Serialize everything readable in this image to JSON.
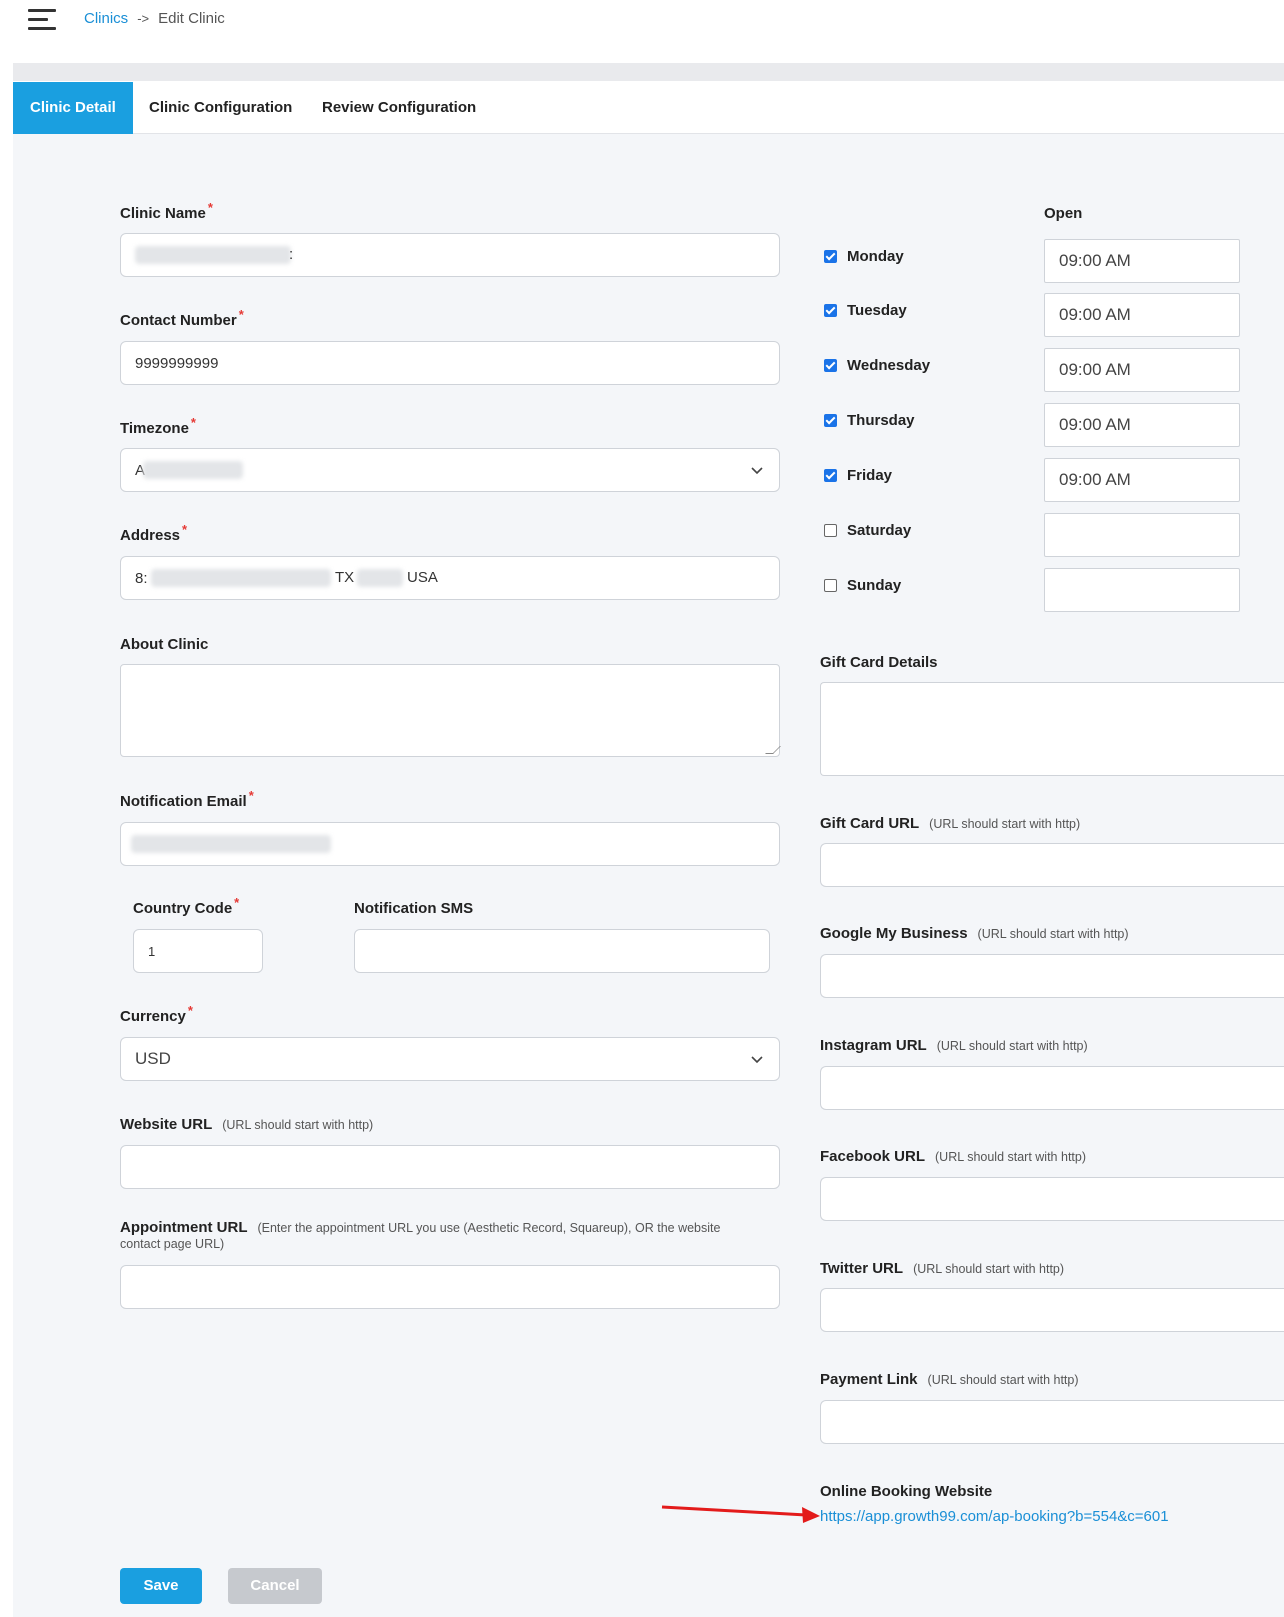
{
  "breadcrumb": {
    "root": "Clinics",
    "separator": "->",
    "current": "Edit Clinic"
  },
  "tabs": [
    {
      "label": "Clinic Detail",
      "active": true
    },
    {
      "label": "Clinic Configuration",
      "active": false
    },
    {
      "label": "Review Configuration",
      "active": false
    }
  ],
  "form": {
    "clinic_name": {
      "label": "Clinic Name",
      "tail": ":"
    },
    "contact_number": {
      "label": "Contact Number",
      "value": "9999999999"
    },
    "timezone": {
      "label": "Timezone",
      "value_start": "A"
    },
    "address": {
      "label": "Address",
      "value_start": "8:",
      "value_mid": "TX",
      "value_end": "USA"
    },
    "about": {
      "label": "About Clinic"
    },
    "notification_email": {
      "label": "Notification Email"
    },
    "country_code": {
      "label": "Country Code",
      "value": "1"
    },
    "notification_sms": {
      "label": "Notification SMS"
    },
    "currency": {
      "label": "Currency",
      "value": "USD"
    },
    "website_url": {
      "label": "Website URL",
      "hint": "(URL should start with http)"
    },
    "appointment_url": {
      "label": "Appointment URL",
      "hint": "(Enter the appointment URL you use (Aesthetic Record, Squareup), OR the website contact page URL)"
    }
  },
  "hours": {
    "open_label": "Open",
    "days": [
      {
        "day": "Monday",
        "checked": true,
        "open": "09:00 AM"
      },
      {
        "day": "Tuesday",
        "checked": true,
        "open": "09:00 AM"
      },
      {
        "day": "Wednesday",
        "checked": true,
        "open": "09:00 AM"
      },
      {
        "day": "Thursday",
        "checked": true,
        "open": "09:00 AM"
      },
      {
        "day": "Friday",
        "checked": true,
        "open": "09:00 AM"
      },
      {
        "day": "Saturday",
        "checked": false,
        "open": ""
      },
      {
        "day": "Sunday",
        "checked": false,
        "open": ""
      }
    ]
  },
  "right_fields": {
    "gift_card_details": {
      "label": "Gift Card Details"
    },
    "gift_card_url": {
      "label": "Gift Card URL",
      "hint": "(URL should start with http)"
    },
    "google_my_business": {
      "label": "Google My Business",
      "hint": "(URL should start with http)"
    },
    "instagram_url": {
      "label": "Instagram URL",
      "hint": "(URL should start with http)"
    },
    "facebook_url": {
      "label": "Facebook URL",
      "hint": "(URL should start with http)"
    },
    "twitter_url": {
      "label": "Twitter URL",
      "hint": "(URL should start with http)"
    },
    "payment_link": {
      "label": "Payment Link",
      "hint": "(URL should start with http)"
    },
    "online_booking": {
      "label": "Online Booking Website",
      "url": "https://app.growth99.com/ap-booking?b=554&c=601"
    }
  },
  "buttons": {
    "save": "Save",
    "cancel": "Cancel"
  },
  "colors": {
    "accent": "#1a9fe0",
    "required": "#e53935",
    "link": "#1a8fd6",
    "annotation_arrow": "#e31b1b"
  }
}
